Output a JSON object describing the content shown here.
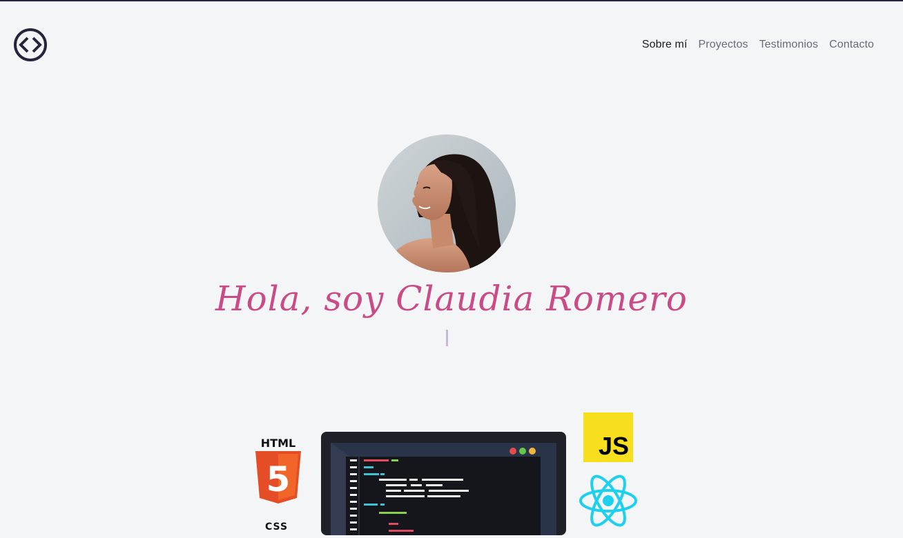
{
  "header": {
    "logo_icon": "code-brackets-icon",
    "nav": [
      {
        "label": "Sobre mí",
        "active": true
      },
      {
        "label": "Proyectos",
        "active": false
      },
      {
        "label": "Testimonios",
        "active": false
      },
      {
        "label": "Contacto",
        "active": false
      }
    ]
  },
  "hero": {
    "title": "Hola, soy Claudia Romero",
    "avatar_icon": "profile-photo"
  },
  "tech": {
    "html_label": "HTML",
    "html_number": "5",
    "css_label": "CSS",
    "js_label": "JS"
  },
  "colors": {
    "accent": "#c94c86",
    "nav_text": "#666b75",
    "nav_active": "#1a1a1a",
    "background": "#f4f5f7"
  }
}
